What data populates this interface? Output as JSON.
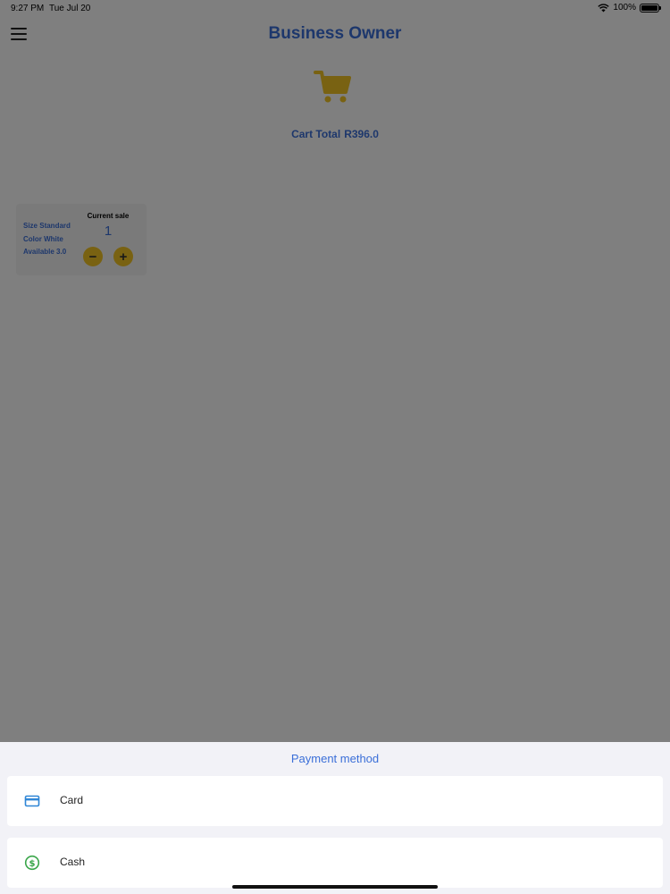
{
  "status_bar": {
    "time": "9:27 PM",
    "date": "Tue Jul 20",
    "battery": "100%"
  },
  "header": {
    "title": "Business Owner"
  },
  "cart": {
    "total_label": "Cart Total",
    "total_value": "R396.0"
  },
  "sale_item": {
    "size": "Size Standard",
    "color": "Color White",
    "available": "Available 3.0",
    "header": "Current sale",
    "quantity": "1",
    "minus_label": "−",
    "plus_label": "+"
  },
  "payment_sheet": {
    "title": "Payment method",
    "options": [
      {
        "label": "Card",
        "icon": "credit-card-icon"
      },
      {
        "label": "Cash",
        "icon": "dollar-circle-icon"
      }
    ]
  },
  "colors": {
    "accent_blue": "#3b6fd8",
    "accent_yellow": "#f2c524",
    "card_icon": "#2f86d6",
    "cash_icon": "#3aa64a"
  }
}
